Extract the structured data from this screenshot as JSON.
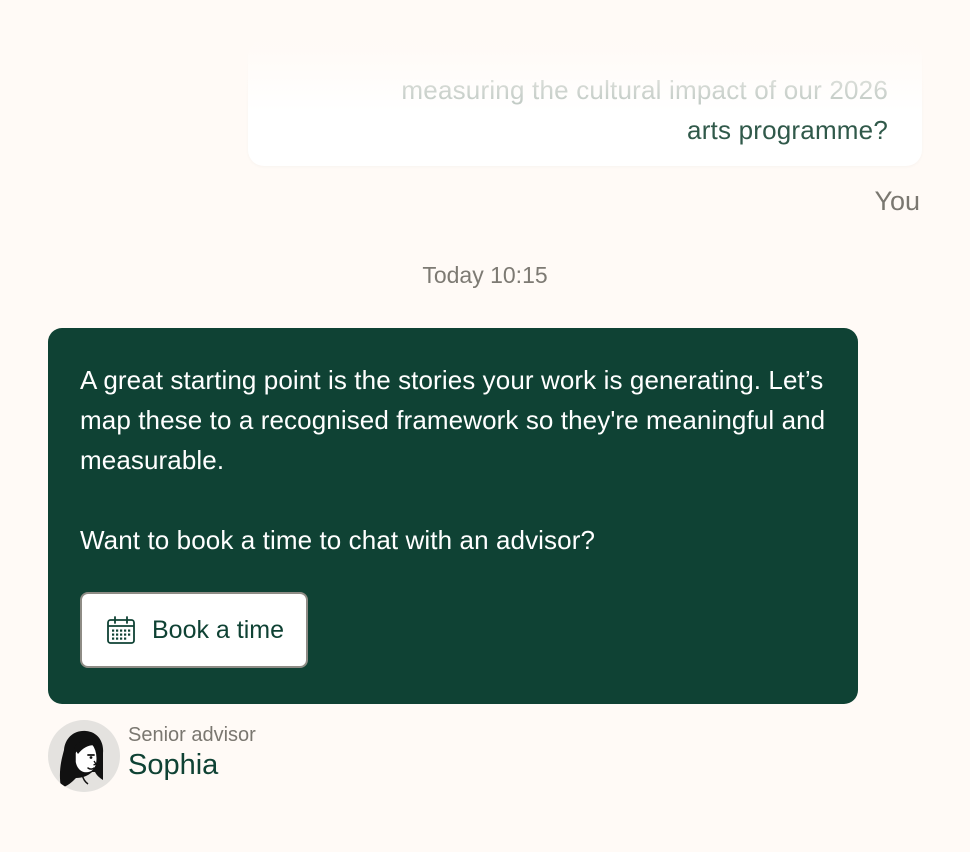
{
  "user_message": {
    "lines": [
      "measuring the cultural impact of our 2026",
      "arts programme?"
    ],
    "sender": "You"
  },
  "timestamp": "Today 10:15",
  "advisor_message": {
    "paragraphs": [
      "A great starting point is the stories your work is generating. Let’s map these to a recognised framework so they're meaningful and measurable.",
      "Want to book a time to chat with an advisor?"
    ],
    "button_label": "Book a time",
    "button_icon": "calendar-icon"
  },
  "advisor": {
    "role": "Senior advisor",
    "name": "Sophia",
    "avatar_icon": "advisor-avatar"
  },
  "colors": {
    "background": "#fffaf6",
    "brand_green": "#0f4234",
    "user_text": "#30594a",
    "muted_text": "#7a7770"
  }
}
